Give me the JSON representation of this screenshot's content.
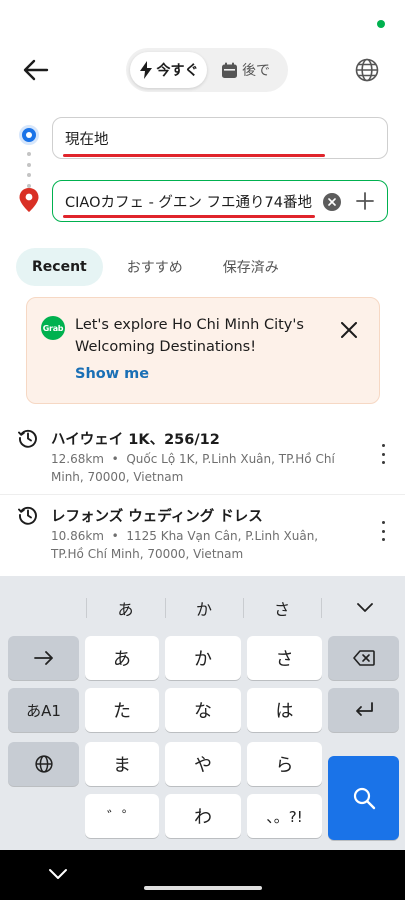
{
  "header": {
    "now_label": "今すぐ",
    "later_label": "後で"
  },
  "route": {
    "origin_value": "現在地",
    "destination_value": "CIAOカフェ - グエン フエ通り74番地"
  },
  "tabs": [
    {
      "label": "Recent",
      "active": true
    },
    {
      "label": "おすすめ",
      "active": false
    },
    {
      "label": "保存済み",
      "active": false
    }
  ],
  "promo": {
    "logo_text": "Grab",
    "message": "Let's explore Ho Chi Minh City's Welcoming Destinations!",
    "link": "Show me"
  },
  "history": [
    {
      "title": "ハイウェイ 1K、256/12",
      "distance": "12.68km",
      "address": "Quốc Lộ 1K, P.Linh Xuân, TP.Hồ Chí Minh, 70000, Vietnam"
    },
    {
      "title": "レフォンズ ウェディング ドレス",
      "distance": "10.86km",
      "address": "1125 Kha Vạn Cân, P.Linh Xuân, TP.Hồ Chí Minh, 70000, Vietnam"
    }
  ],
  "keyboard": {
    "suggestions": [
      "あ",
      "か",
      "さ"
    ],
    "keys": {
      "a": "あ",
      "ka": "か",
      "sa": "さ",
      "ta": "た",
      "na": "な",
      "ha": "は",
      "ma": "ま",
      "ya": "や",
      "ra": "ら",
      "dakuten": "゛゜",
      "wa": "わ",
      "punct": "、。?!",
      "mode": "あA1"
    }
  },
  "colors": {
    "brand_green": "#00b14f",
    "origin_blue": "#1a73e8",
    "destination_red": "#d93025",
    "annotation_red": "#e0242b",
    "link_blue": "#1a6fb5",
    "promo_bg": "#fdf1e9"
  },
  "icons": {
    "back": "arrow-left-icon",
    "now": "lightning-icon",
    "later": "calendar-icon",
    "language": "globe-icon",
    "history": "history-clock-icon"
  }
}
